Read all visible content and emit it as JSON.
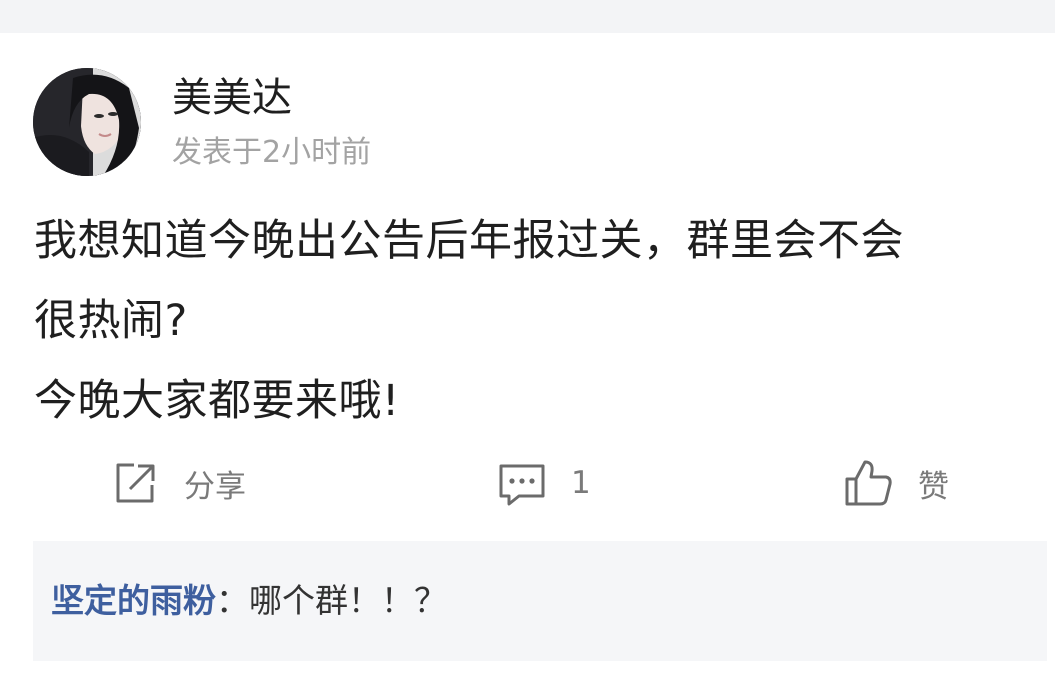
{
  "post": {
    "author": "美美达",
    "time": "发表于2小时前",
    "lines": [
      "我想知道今晚出公告后年报过关，群里会不会",
      "很热闹?",
      "今晚大家都要来哦!"
    ]
  },
  "actions": {
    "share_label": "分享",
    "comment_count": "1",
    "like_label": "赞"
  },
  "comment": {
    "author": "坚定的雨粉",
    "text": "：哪个群！！？"
  },
  "icons": [
    "share-icon",
    "comment-icon",
    "thumbs-up-icon"
  ],
  "colors": {
    "commenter_name": "#3e5f9f",
    "secondary_text": "#a3a3a3",
    "comment_bg": "#f5f6f8"
  }
}
